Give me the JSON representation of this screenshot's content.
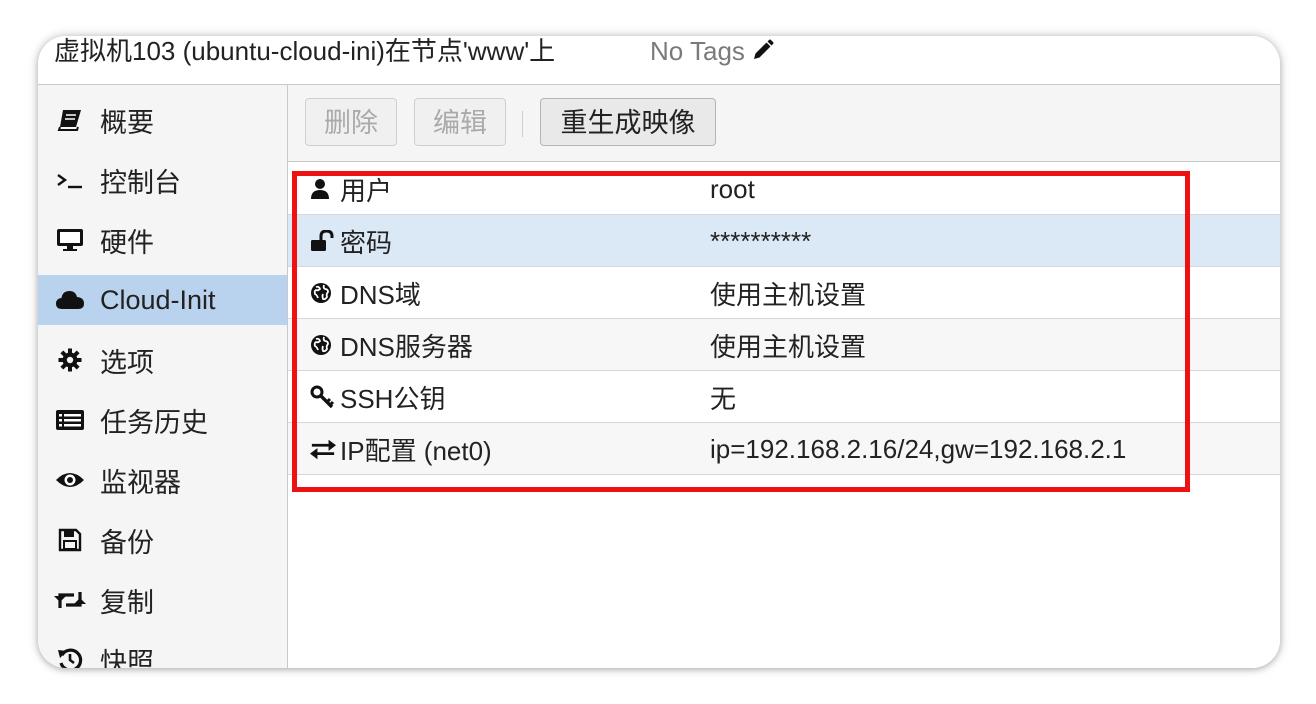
{
  "title": "虚拟机103 (ubuntu-cloud-ini)在节点'www'上",
  "tags_label": "No Tags",
  "sidebar": {
    "items": [
      {
        "label": "概要",
        "icon": "book-icon"
      },
      {
        "label": "控制台",
        "icon": "terminal-icon"
      },
      {
        "label": "硬件",
        "icon": "monitor-icon"
      },
      {
        "label": "Cloud-Init",
        "icon": "cloud-icon",
        "active": true
      },
      {
        "label": "选项",
        "icon": "gear-icon"
      },
      {
        "label": "任务历史",
        "icon": "list-icon"
      },
      {
        "label": "监视器",
        "icon": "eye-icon"
      },
      {
        "label": "备份",
        "icon": "floppy-icon"
      },
      {
        "label": "复制",
        "icon": "retweet-icon"
      },
      {
        "label": "快照",
        "icon": "history-icon"
      }
    ]
  },
  "toolbar": {
    "delete_label": "删除",
    "edit_label": "编辑",
    "regenerate_label": "重生成映像"
  },
  "grid": {
    "rows": [
      {
        "key": "用户",
        "value": "root",
        "icon": "user-icon"
      },
      {
        "key": "密码",
        "value": "**********",
        "icon": "unlock-icon",
        "selected": true
      },
      {
        "key": "DNS域",
        "value": "使用主机设置",
        "icon": "globe-icon"
      },
      {
        "key": "DNS服务器",
        "value": "使用主机设置",
        "icon": "globe-icon"
      },
      {
        "key": "SSH公钥",
        "value": "无",
        "icon": "key-icon"
      },
      {
        "key": "IP配置 (net0)",
        "value": "ip=192.168.2.16/24,gw=192.168.2.1",
        "icon": "exchange-icon"
      }
    ]
  },
  "colors": {
    "active_nav": "#b9d3ef",
    "selected_row": "#dbe8f6",
    "highlight_border": "#ee1111"
  }
}
